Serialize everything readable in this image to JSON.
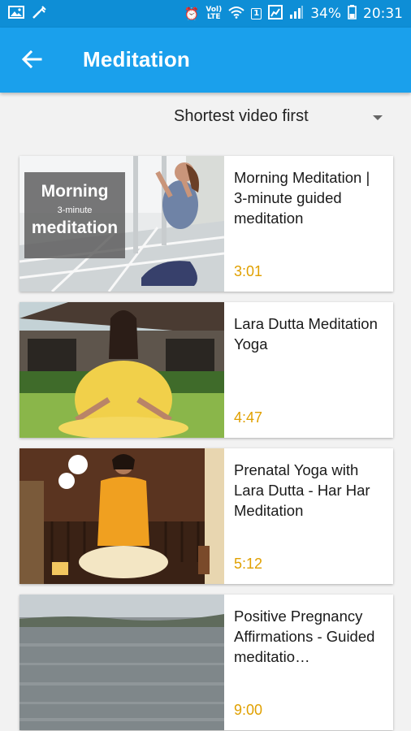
{
  "status_bar": {
    "battery": "34%",
    "time": "20:31",
    "volte_top": "Vol)",
    "volte_bottom": "LTE",
    "sim_badge": "1"
  },
  "app_bar": {
    "title": "Meditation"
  },
  "sort": {
    "selected": "Shortest video first"
  },
  "videos": [
    {
      "title": "Morning Meditation | 3-minute guided meditation",
      "duration": "3:01",
      "thumbnail_overlay": {
        "line1": "Morning",
        "line2": "3-minute",
        "line3": "meditation"
      }
    },
    {
      "title": "Lara Dutta Meditation Yoga",
      "duration": "4:47"
    },
    {
      "title": "Prenatal Yoga with Lara Dutta - Har Har Meditation",
      "duration": "5:12"
    },
    {
      "title": "Positive Pregnancy Affirmations - Guided meditatio…",
      "duration": "9:00"
    }
  ],
  "colors": {
    "status_bar": "#0e8ed6",
    "app_bar": "#1aa0ec",
    "duration_text": "#e0a000",
    "background": "#f2f2f2"
  }
}
